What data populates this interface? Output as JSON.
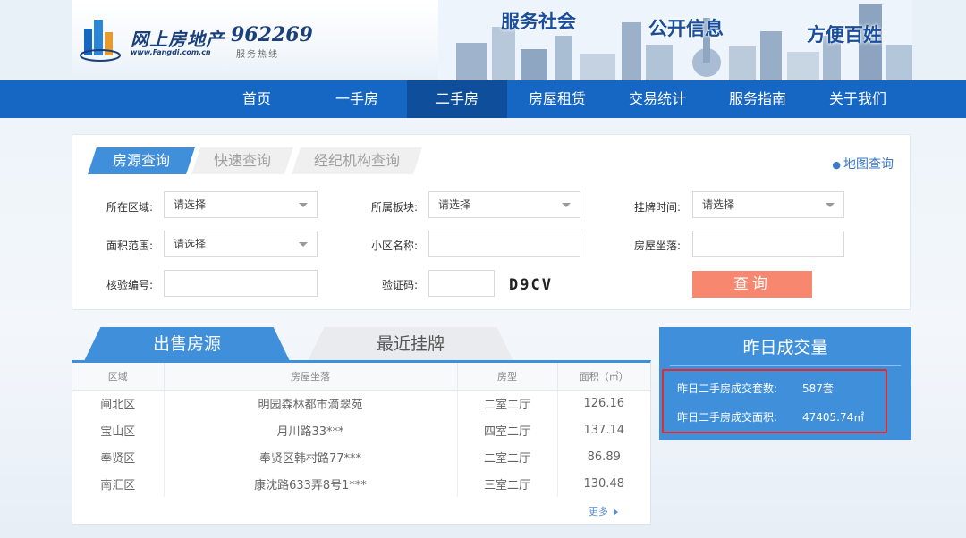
{
  "header": {
    "logo_text": "网上房地产",
    "logo_sub": "www.Fangdi.com.cn",
    "hotline": "962269",
    "hotline_sub": "服务热线",
    "slogans": [
      "服务社会",
      "公开信息",
      "方便百姓"
    ]
  },
  "nav": {
    "items": [
      {
        "label": "首页"
      },
      {
        "label": "一手房"
      },
      {
        "label": "二手房"
      },
      {
        "label": "房屋租赁"
      },
      {
        "label": "交易统计"
      },
      {
        "label": "服务指南"
      },
      {
        "label": "关于我们"
      }
    ],
    "active_label": "二手房"
  },
  "search": {
    "tabs": [
      "房源查询",
      "快速查询",
      "经纪机构查询"
    ],
    "active_tab": "房源查询",
    "map_link": "地图查询",
    "fields": {
      "district": {
        "label": "所在区域:",
        "value": "请选择"
      },
      "block": {
        "label": "所属板块:",
        "value": "请选择"
      },
      "listing_time": {
        "label": "挂牌时间:",
        "value": "请选择"
      },
      "area_range": {
        "label": "面积范围:",
        "value": "请选择"
      },
      "community": {
        "label": "小区名称:",
        "value": ""
      },
      "address": {
        "label": "房屋坐落:",
        "value": ""
      },
      "verify_no": {
        "label": "核验编号:",
        "value": ""
      },
      "captcha": {
        "label": "验证码:",
        "value": "",
        "image_text": "D9CV"
      }
    },
    "query_button": "查询"
  },
  "listings": {
    "tabs": [
      "出售房源",
      "最近挂牌"
    ],
    "active_tab": "出售房源",
    "columns": [
      "区域",
      "房屋坐落",
      "房型",
      "面积（㎡）"
    ],
    "rows": [
      {
        "district": "闸北区",
        "address": "明园森林都市滴翠苑",
        "layout": "二室二厅",
        "area": "126.16"
      },
      {
        "district": "宝山区",
        "address": "月川路33***",
        "layout": "四室二厅",
        "area": "137.14"
      },
      {
        "district": "奉贤区",
        "address": "奉贤区韩村路77***",
        "layout": "二室二厅",
        "area": "86.89"
      },
      {
        "district": "南汇区",
        "address": "康沈路633弄8号1***",
        "layout": "三室二厅",
        "area": "130.48"
      }
    ],
    "more_link": "更多"
  },
  "stats": {
    "title": "昨日成交量",
    "count_label": "昨日二手房成交套数:",
    "count_value": "587套",
    "area_label": "昨日二手房成交面积:",
    "area_value": "47405.74㎡"
  },
  "colors": {
    "nav_bg": "#1667c4",
    "nav_active": "#0e4e9a",
    "accent_blue": "#3f8fdb",
    "query_button": "#f7876f",
    "highlight_border": "#e22b2b"
  }
}
